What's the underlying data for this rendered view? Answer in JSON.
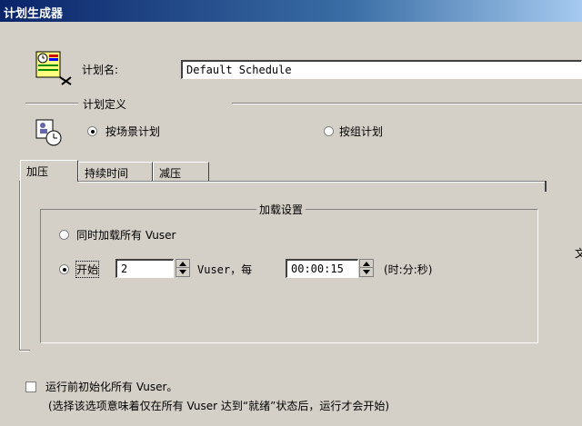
{
  "window": {
    "title": "计划生成器"
  },
  "schedule": {
    "name_label": "计划名:",
    "name_value": "Default Schedule"
  },
  "definition": {
    "legend": "计划定义",
    "by_scenario": "按场景计划",
    "by_group": "按组计划",
    "by_scenario_selected": true
  },
  "tabs": [
    "加压",
    "持续时间",
    "减压"
  ],
  "load_settings": {
    "legend": "加载设置",
    "option_all": "同时加载所有 Vuser",
    "option_start": "开始",
    "start_count": "2",
    "vuser_every": "Vuser，每",
    "interval": "00:00:15",
    "time_format": "(时:分:秒)"
  },
  "init": {
    "checkbox_label": "运行前初始化所有 Vuser。",
    "note": "(选择该选项意味着仅在所有 Vuser 达到“就绪”状态后，运行才会开始)"
  },
  "icons": {
    "schedule": "schedule-icon",
    "scenario": "scenario-clock-icon"
  }
}
